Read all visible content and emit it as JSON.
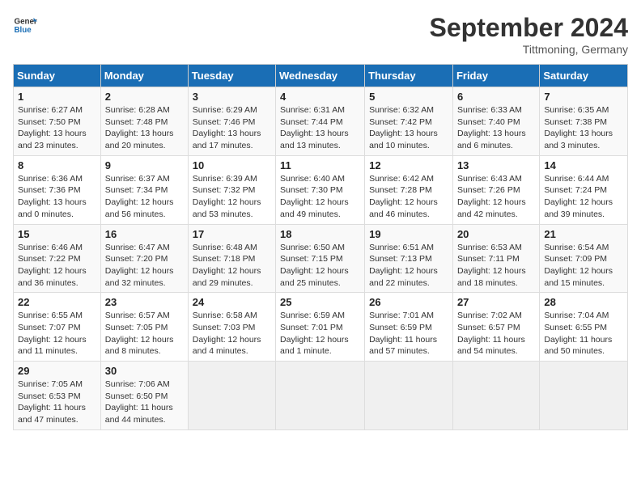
{
  "header": {
    "logo_line1": "General",
    "logo_line2": "Blue",
    "month": "September 2024",
    "location": "Tittmoning, Germany"
  },
  "days_of_week": [
    "Sunday",
    "Monday",
    "Tuesday",
    "Wednesday",
    "Thursday",
    "Friday",
    "Saturday"
  ],
  "weeks": [
    [
      {
        "day": "1",
        "sunrise": "6:27 AM",
        "sunset": "7:50 PM",
        "daylight": "13 hours and 23 minutes."
      },
      {
        "day": "2",
        "sunrise": "6:28 AM",
        "sunset": "7:48 PM",
        "daylight": "13 hours and 20 minutes."
      },
      {
        "day": "3",
        "sunrise": "6:29 AM",
        "sunset": "7:46 PM",
        "daylight": "13 hours and 17 minutes."
      },
      {
        "day": "4",
        "sunrise": "6:31 AM",
        "sunset": "7:44 PM",
        "daylight": "13 hours and 13 minutes."
      },
      {
        "day": "5",
        "sunrise": "6:32 AM",
        "sunset": "7:42 PM",
        "daylight": "13 hours and 10 minutes."
      },
      {
        "day": "6",
        "sunrise": "6:33 AM",
        "sunset": "7:40 PM",
        "daylight": "13 hours and 6 minutes."
      },
      {
        "day": "7",
        "sunrise": "6:35 AM",
        "sunset": "7:38 PM",
        "daylight": "13 hours and 3 minutes."
      }
    ],
    [
      {
        "day": "8",
        "sunrise": "6:36 AM",
        "sunset": "7:36 PM",
        "daylight": "13 hours and 0 minutes."
      },
      {
        "day": "9",
        "sunrise": "6:37 AM",
        "sunset": "7:34 PM",
        "daylight": "12 hours and 56 minutes."
      },
      {
        "day": "10",
        "sunrise": "6:39 AM",
        "sunset": "7:32 PM",
        "daylight": "12 hours and 53 minutes."
      },
      {
        "day": "11",
        "sunrise": "6:40 AM",
        "sunset": "7:30 PM",
        "daylight": "12 hours and 49 minutes."
      },
      {
        "day": "12",
        "sunrise": "6:42 AM",
        "sunset": "7:28 PM",
        "daylight": "12 hours and 46 minutes."
      },
      {
        "day": "13",
        "sunrise": "6:43 AM",
        "sunset": "7:26 PM",
        "daylight": "12 hours and 42 minutes."
      },
      {
        "day": "14",
        "sunrise": "6:44 AM",
        "sunset": "7:24 PM",
        "daylight": "12 hours and 39 minutes."
      }
    ],
    [
      {
        "day": "15",
        "sunrise": "6:46 AM",
        "sunset": "7:22 PM",
        "daylight": "12 hours and 36 minutes."
      },
      {
        "day": "16",
        "sunrise": "6:47 AM",
        "sunset": "7:20 PM",
        "daylight": "12 hours and 32 minutes."
      },
      {
        "day": "17",
        "sunrise": "6:48 AM",
        "sunset": "7:18 PM",
        "daylight": "12 hours and 29 minutes."
      },
      {
        "day": "18",
        "sunrise": "6:50 AM",
        "sunset": "7:15 PM",
        "daylight": "12 hours and 25 minutes."
      },
      {
        "day": "19",
        "sunrise": "6:51 AM",
        "sunset": "7:13 PM",
        "daylight": "12 hours and 22 minutes."
      },
      {
        "day": "20",
        "sunrise": "6:53 AM",
        "sunset": "7:11 PM",
        "daylight": "12 hours and 18 minutes."
      },
      {
        "day": "21",
        "sunrise": "6:54 AM",
        "sunset": "7:09 PM",
        "daylight": "12 hours and 15 minutes."
      }
    ],
    [
      {
        "day": "22",
        "sunrise": "6:55 AM",
        "sunset": "7:07 PM",
        "daylight": "12 hours and 11 minutes."
      },
      {
        "day": "23",
        "sunrise": "6:57 AM",
        "sunset": "7:05 PM",
        "daylight": "12 hours and 8 minutes."
      },
      {
        "day": "24",
        "sunrise": "6:58 AM",
        "sunset": "7:03 PM",
        "daylight": "12 hours and 4 minutes."
      },
      {
        "day": "25",
        "sunrise": "6:59 AM",
        "sunset": "7:01 PM",
        "daylight": "12 hours and 1 minute."
      },
      {
        "day": "26",
        "sunrise": "7:01 AM",
        "sunset": "6:59 PM",
        "daylight": "11 hours and 57 minutes."
      },
      {
        "day": "27",
        "sunrise": "7:02 AM",
        "sunset": "6:57 PM",
        "daylight": "11 hours and 54 minutes."
      },
      {
        "day": "28",
        "sunrise": "7:04 AM",
        "sunset": "6:55 PM",
        "daylight": "11 hours and 50 minutes."
      }
    ],
    [
      {
        "day": "29",
        "sunrise": "7:05 AM",
        "sunset": "6:53 PM",
        "daylight": "11 hours and 47 minutes."
      },
      {
        "day": "30",
        "sunrise": "7:06 AM",
        "sunset": "6:50 PM",
        "daylight": "11 hours and 44 minutes."
      },
      null,
      null,
      null,
      null,
      null
    ]
  ]
}
